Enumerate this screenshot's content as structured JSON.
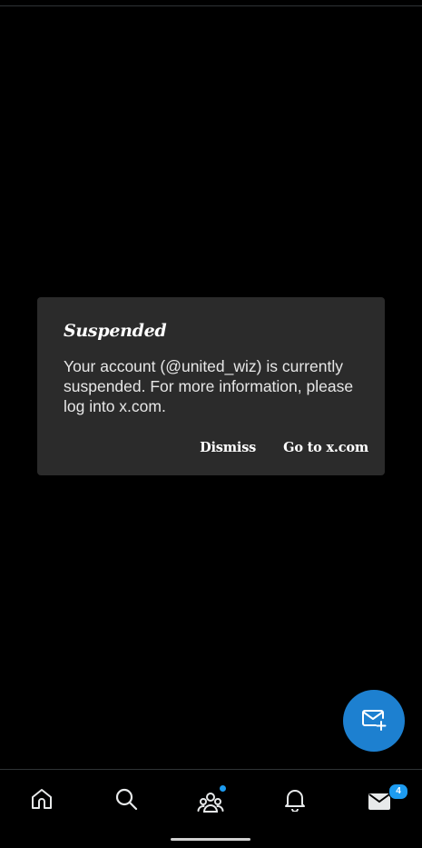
{
  "dialog": {
    "title": "Suspended",
    "message": "Your account (@united_wiz) is currently suspended. For more information, please log into x.com.",
    "dismiss_label": "Dismiss",
    "goto_label": "Go to x.com"
  },
  "fab": {
    "icon": "new-message-icon",
    "color": "#1d80d0"
  },
  "bottom_nav": {
    "items": [
      {
        "name": "home",
        "icon": "home-icon"
      },
      {
        "name": "search",
        "icon": "search-icon"
      },
      {
        "name": "communities",
        "icon": "communities-icon",
        "has_dot": true
      },
      {
        "name": "notifications",
        "icon": "bell-icon"
      },
      {
        "name": "messages",
        "icon": "mail-icon",
        "badge": "4"
      }
    ]
  },
  "colors": {
    "background": "#000000",
    "dialog_bg": "#2b2b2b",
    "accent": "#1d9bf0"
  }
}
